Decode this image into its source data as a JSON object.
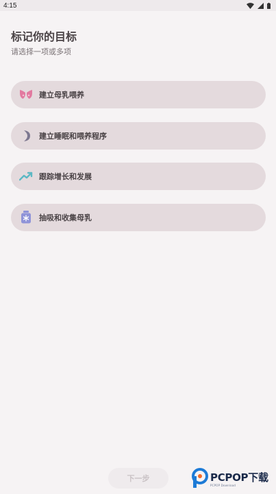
{
  "status_bar": {
    "time": "4:15",
    "icons": [
      "wifi-icon",
      "signal-icon",
      "battery-icon"
    ]
  },
  "page": {
    "title": "标记你的目标",
    "subtitle": "请选择一项或多项"
  },
  "options": [
    {
      "label": "建立母乳喂养",
      "icon": "breastfeeding-icon",
      "color": "#e27aa0"
    },
    {
      "label": "建立睡眠和喂养程序",
      "icon": "moon-icon",
      "color": "#7d7890"
    },
    {
      "label": "跟踪增长和发展",
      "icon": "trend-up-icon",
      "color": "#5cb8c4"
    },
    {
      "label": "抽吸和收集母乳",
      "icon": "milk-bottle-icon",
      "color": "#8f93d8"
    }
  ],
  "footer": {
    "next_label": "下一步"
  },
  "watermark": {
    "main": "PCPOP下载",
    "sub": "PCPOP Download"
  },
  "colors": {
    "background": "#f6f3f4",
    "option_bg": "#e4dadd",
    "text": "#4a4346"
  }
}
